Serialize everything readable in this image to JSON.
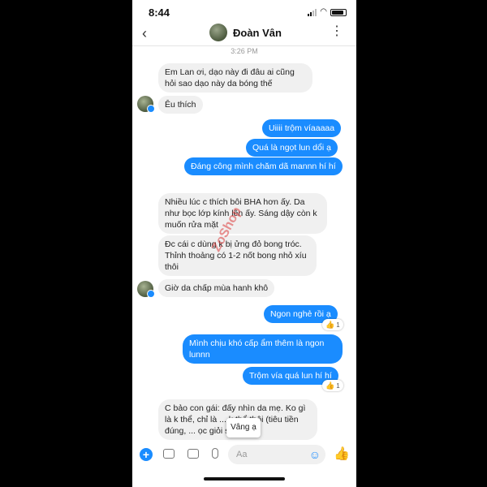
{
  "status_bar": {
    "time": "8:44"
  },
  "header": {
    "contact_name": "Đoàn Vân",
    "back_icon": "chevron-left-icon",
    "more_icon": "more-vertical-icon"
  },
  "timestamp": "3:26 PM",
  "messages": [
    {
      "side": "in",
      "text": "Em Lan ơi, dạo này đi đâu ai cũng hỏi sao dạo này da bóng thế"
    },
    {
      "side": "in",
      "text": "Êu thích"
    },
    {
      "side": "out",
      "text": "Uiiii trộm víaaaaa"
    },
    {
      "side": "out",
      "text": "Quá là ngọt lun dổi ạ"
    },
    {
      "side": "out",
      "text": "Đáng công mình chăm dã mannn hí hí"
    },
    {
      "side": "in",
      "text": "Nhiều lúc c thích bôi BHA hơn ấy. Da như bọc lớp kính lên ấy. Sáng dậy còn k muốn rửa mặt"
    },
    {
      "side": "in",
      "text": "Đc cái c dùng k bị ửng đỏ bong tróc. Thỉnh thoảng có 1-2 nốt bong nhỏ xíu thôi"
    },
    {
      "side": "in",
      "text": "Giờ da chấp mùa hanh khô"
    },
    {
      "side": "out",
      "text": "Ngon nghẻ rồi ạ",
      "reaction_count": "1"
    },
    {
      "side": "out",
      "text": "Mình chịu khó cấp ẩm thêm là ngon lunnn"
    },
    {
      "side": "out",
      "text": "Trộm vía quá lun hí hí",
      "reaction_count": "1"
    },
    {
      "side": "in",
      "text": "C bảo con gái: đấy nhìn da mẹ. Ko gì là k thể, chỉ là ... k thể thôi (tiêu tiền đúng, ... ọc giỏi sau"
    }
  ],
  "popup": {
    "text": "Vâng ạ"
  },
  "watermark": {
    "text": "ZoShop"
  },
  "composer": {
    "placeholder": "Aa"
  },
  "colors": {
    "accent": "#1a8cff",
    "incoming_bubble": "#f0f0f0"
  }
}
